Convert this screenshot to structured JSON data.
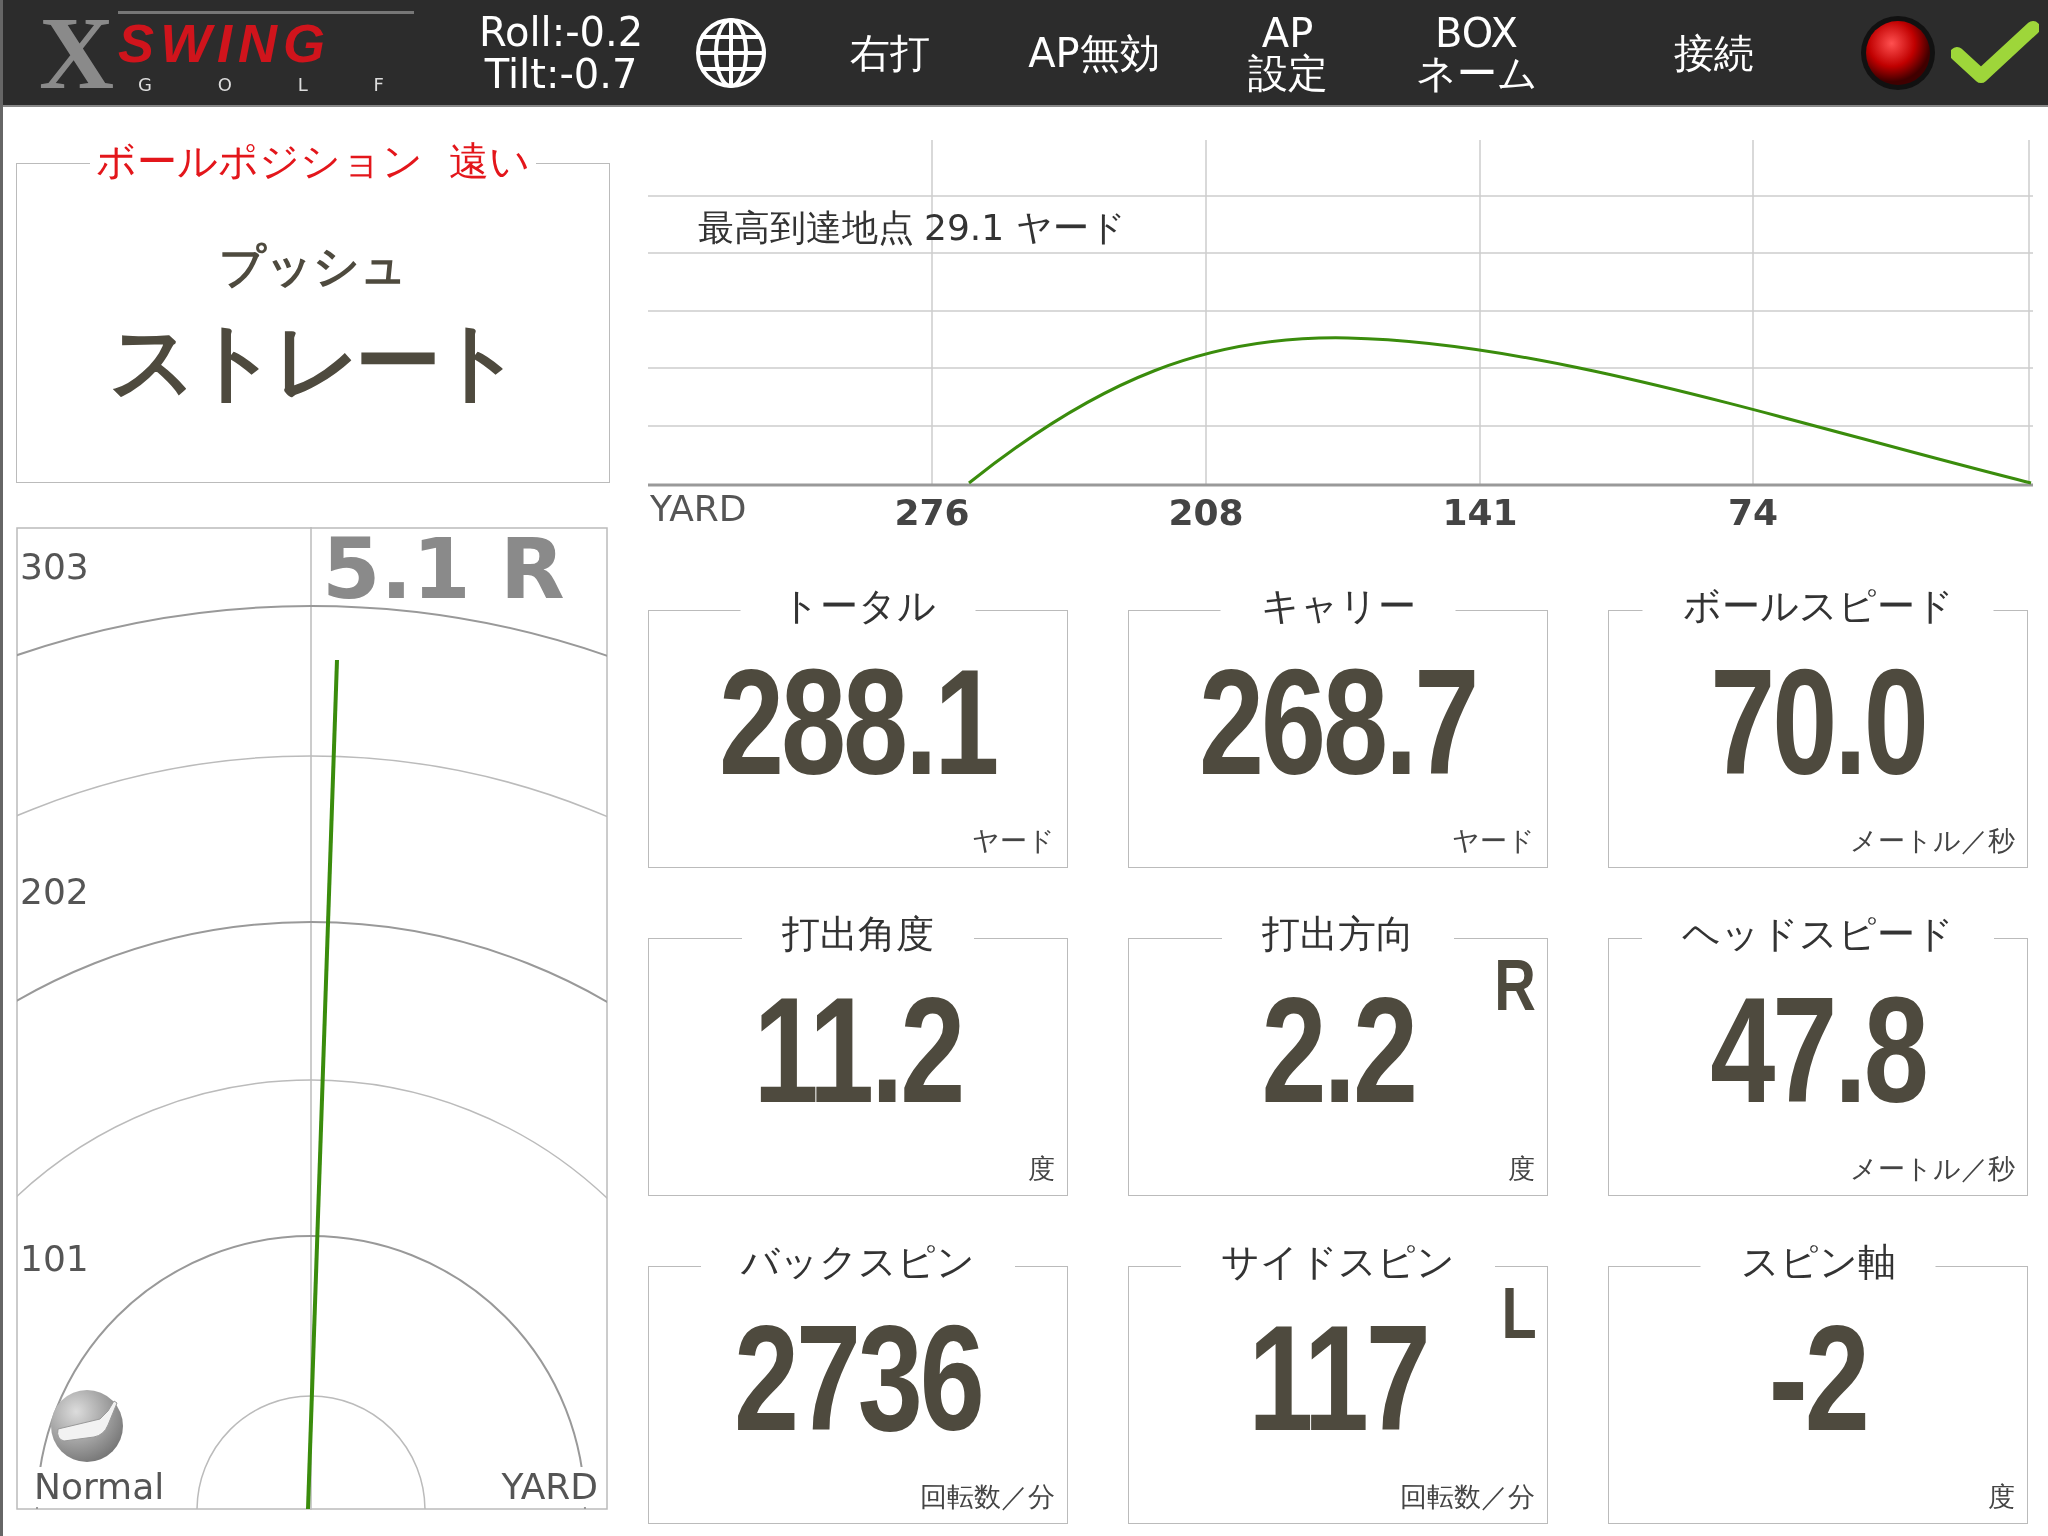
{
  "top_bar": {
    "logo": {
      "mark": "X",
      "word": "SWING",
      "sub": "G O L F"
    },
    "roll": "Roll:-0.2",
    "tilt": "Tilt:-0.7",
    "buttons": [
      {
        "lines": [
          "右打"
        ]
      },
      {
        "lines": [
          "AP無効"
        ]
      },
      {
        "lines": [
          "AP",
          "設定"
        ]
      },
      {
        "lines": [
          "BOX",
          "ネーム"
        ]
      },
      {
        "lines": [
          "接続"
        ]
      }
    ]
  },
  "ball_position": {
    "label": "ボールポジション",
    "value": "遠い"
  },
  "shot_shape": {
    "direction": "プッシュ",
    "curve": "ストレート"
  },
  "overhead": {
    "deviation": "5.1 R",
    "scale": [
      "303",
      "202",
      "101"
    ],
    "club": "Normal",
    "unit": "YARD"
  },
  "trajectory": {
    "apex_label": "最高到達地点",
    "apex_value": "29.1 ヤード",
    "unit": "YARD",
    "ticks": [
      "276",
      "208",
      "141",
      "74"
    ]
  },
  "stats": [
    {
      "title": "トータル",
      "value": "288.1",
      "unit": "ヤード"
    },
    {
      "title": "キャリー",
      "value": "268.7",
      "unit": "ヤード"
    },
    {
      "title": "ボールスピード",
      "value": "70.0",
      "unit": "メートル／秒"
    },
    {
      "title": "打出角度",
      "value": "11.2",
      "unit": "度"
    },
    {
      "title": "打出方向",
      "value": "2.2",
      "unit": "度",
      "corner": "R"
    },
    {
      "title": "ヘッドスピード",
      "value": "47.8",
      "unit": "メートル／秒"
    },
    {
      "title": "バックスピン",
      "value": "2736",
      "unit": "回転数／分"
    },
    {
      "title": "サイドスピン",
      "value": "117",
      "unit": "回転数／分",
      "corner": "L"
    },
    {
      "title": "スピン軸",
      "value": "-2",
      "unit": "度"
    }
  ]
}
